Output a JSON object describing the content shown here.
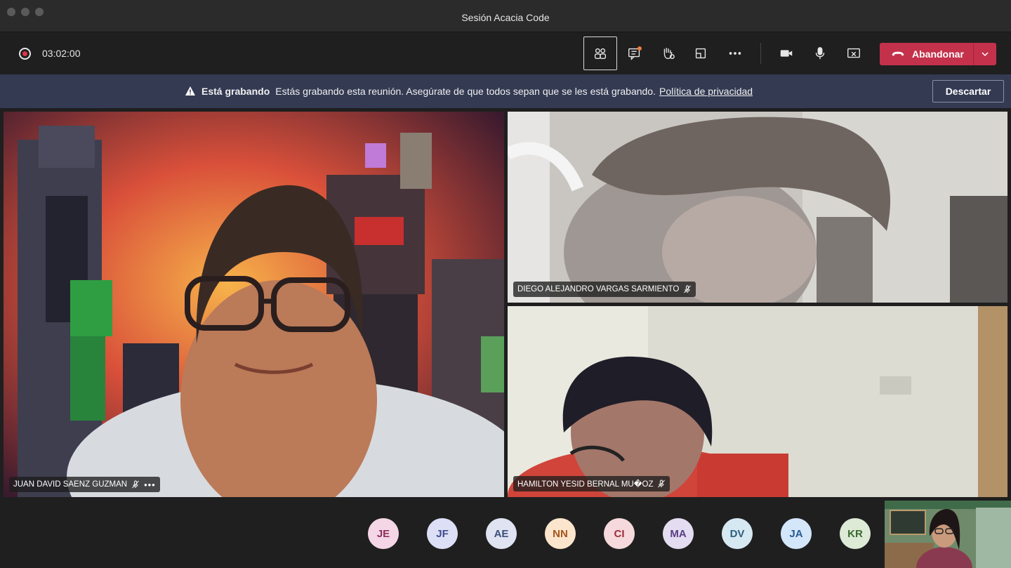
{
  "window": {
    "title": "Sesión Acacia Code"
  },
  "toolbar": {
    "timer": "03:02:00",
    "leave_label": "Abandonar",
    "icons": [
      "participants-icon",
      "chat-icon",
      "raise-hand-icon",
      "share-tray-icon",
      "more-icon",
      "camera-icon",
      "mic-icon",
      "stop-share-icon"
    ]
  },
  "banner": {
    "title": "Está grabando",
    "message": "Estás grabando esta reunión. Asegúrate de que todos sepan que se les está grabando.",
    "link": "Política de privacidad",
    "dismiss_label": "Descartar"
  },
  "participants": [
    {
      "name": "JUAN DAVID SAENZ GUZMAN",
      "muted": true
    },
    {
      "name": "DIEGO ALEJANDRO VARGAS SARMIENTO",
      "muted": true
    },
    {
      "name": "HAMILTON YESID BERNAL MU�OZ",
      "muted": true
    }
  ],
  "avatars": [
    {
      "initials": "JE",
      "bg": "#f4d6e7",
      "fg": "#8d2f5c"
    },
    {
      "initials": "JF",
      "bg": "#dcdff5",
      "fg": "#3e4a8f"
    },
    {
      "initials": "AE",
      "bg": "#dfe3f2",
      "fg": "#3d4f7d"
    },
    {
      "initials": "NN",
      "bg": "#fbe5cc",
      "fg": "#a3551b"
    },
    {
      "initials": "CI",
      "bg": "#f6d9dc",
      "fg": "#9c2d3c"
    },
    {
      "initials": "MA",
      "bg": "#e4dcf0",
      "fg": "#5a3d86"
    },
    {
      "initials": "DV",
      "bg": "#d6e8f2",
      "fg": "#2d5f7d"
    },
    {
      "initials": "JA",
      "bg": "#d3e6fa",
      "fg": "#275b93"
    },
    {
      "initials": "KR",
      "bg": "#dcead6",
      "fg": "#3b6a2f"
    }
  ],
  "colors": {
    "leave": "#c4314b",
    "banner": "#333a52",
    "record": "#e0334c"
  }
}
